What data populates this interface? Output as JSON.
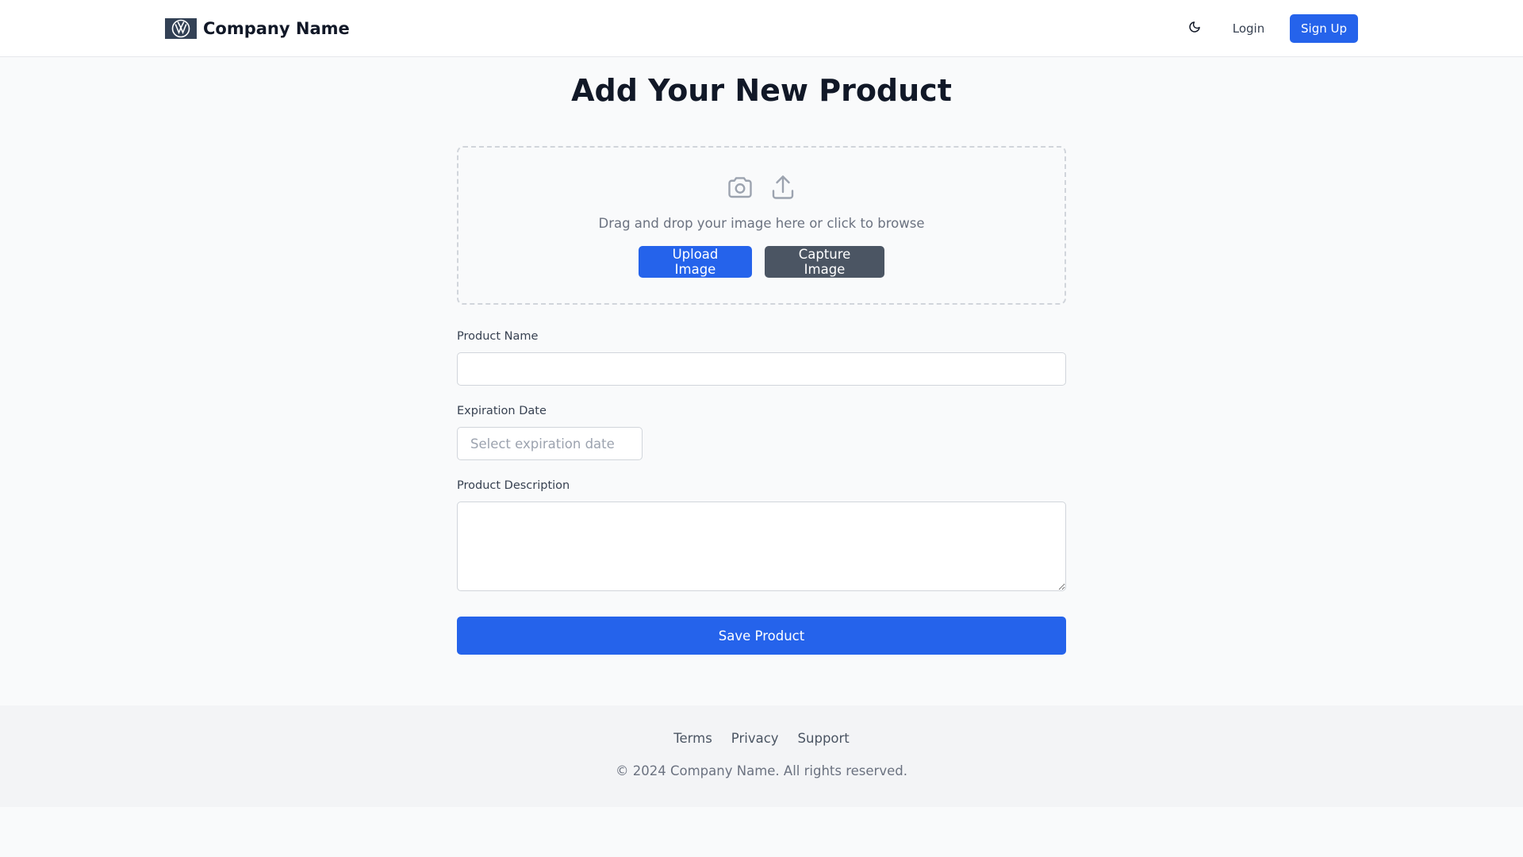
{
  "header": {
    "brand_name": "Company Name",
    "logo_icon": "volkswagen-logo",
    "theme_icon": "moon-icon",
    "login_label": "Login",
    "signup_label": "Sign Up"
  },
  "page": {
    "title": "Add Your New Product"
  },
  "upload": {
    "icons": [
      "camera-icon",
      "upload-icon"
    ],
    "hint": "Drag and drop your image here or click to browse",
    "upload_label": "Upload Image",
    "capture_label": "Capture Image"
  },
  "form": {
    "product_name": {
      "label": "Product Name",
      "value": "",
      "placeholder": ""
    },
    "expiration_date": {
      "label": "Expiration Date",
      "value": "",
      "placeholder": "Select expiration date"
    },
    "description": {
      "label": "Product Description",
      "value": "",
      "placeholder": ""
    },
    "save_label": "Save Product"
  },
  "footer": {
    "links": [
      "Terms",
      "Privacy",
      "Support"
    ],
    "copyright": "© 2024 Company Name. All rights reserved."
  },
  "colors": {
    "primary": "#2563eb",
    "secondary": "#4b5563",
    "background": "#f9fafb",
    "footer_bg": "#f3f4f6"
  }
}
